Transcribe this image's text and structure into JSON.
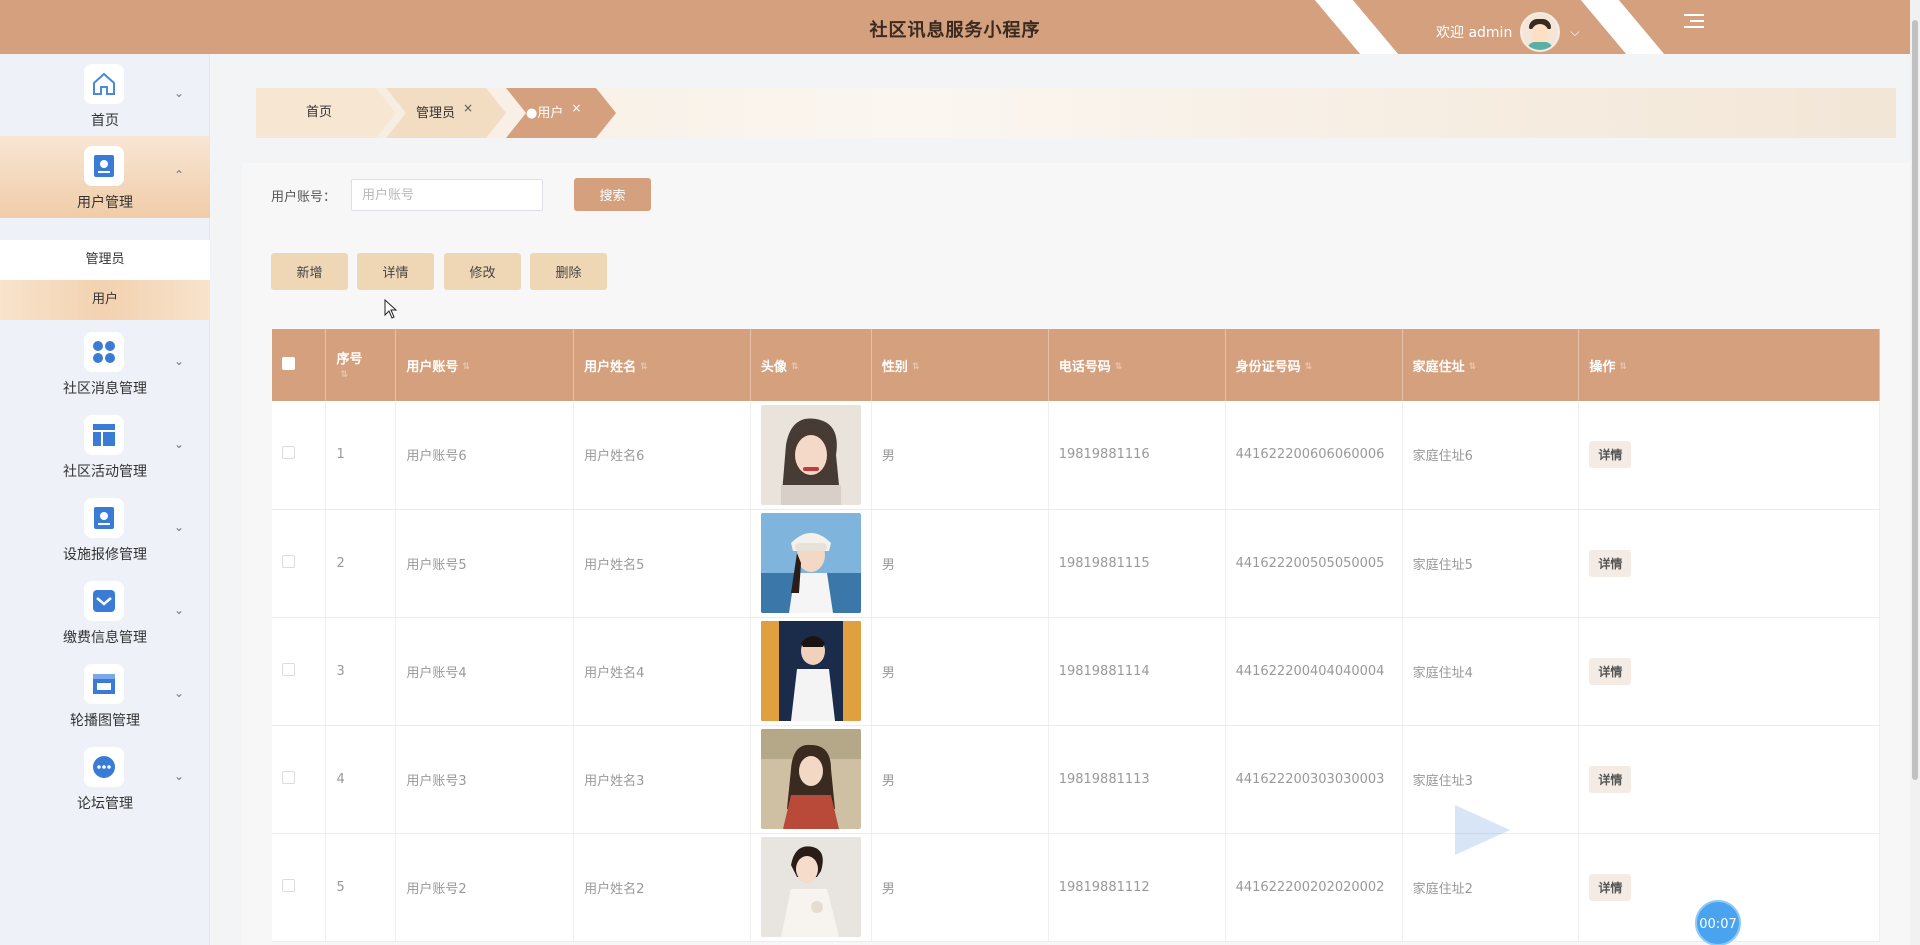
{
  "header": {
    "title": "社区讯息服务小程序",
    "welcome": "欢迎 admin",
    "colors": {
      "brand": "#d4a07e",
      "accent_light": "#efd7b6"
    }
  },
  "sidebar": {
    "items": [
      {
        "label": "首页",
        "icon": "home-icon"
      },
      {
        "label": "用户管理",
        "icon": "user-manage-icon"
      },
      {
        "label": "社区消息管理",
        "icon": "grid-icon"
      },
      {
        "label": "社区活动管理",
        "icon": "layout-icon"
      },
      {
        "label": "设施报修管理",
        "icon": "badge-icon"
      },
      {
        "label": "缴费信息管理",
        "icon": "mail-icon"
      },
      {
        "label": "轮播图管理",
        "icon": "store-icon"
      },
      {
        "label": "论坛管理",
        "icon": "chat-icon"
      }
    ],
    "sub_items": [
      "管理员",
      "用户"
    ]
  },
  "tabs": [
    {
      "label": "首页"
    },
    {
      "label": "管理员"
    },
    {
      "label": "●用户"
    }
  ],
  "search": {
    "label": "用户账号：",
    "placeholder": "用户账号",
    "button": "搜索"
  },
  "actions": [
    "新增",
    "详情",
    "修改",
    "删除"
  ],
  "table": {
    "headers": [
      "序号",
      "用户账号",
      "用户姓名",
      "头像",
      "性别",
      "电话号码",
      "身份证号码",
      "家庭住址",
      "操作"
    ],
    "rows": [
      {
        "index": "1",
        "account": "用户账号6",
        "name": "用户姓名6",
        "gender": "男",
        "phone": "19819881116",
        "id_card": "441622200606060006",
        "address": "家庭住址6",
        "op": "详情"
      },
      {
        "index": "2",
        "account": "用户账号5",
        "name": "用户姓名5",
        "gender": "男",
        "phone": "19819881115",
        "id_card": "441622200505050005",
        "address": "家庭住址5",
        "op": "详情"
      },
      {
        "index": "3",
        "account": "用户账号4",
        "name": "用户姓名4",
        "gender": "男",
        "phone": "19819881114",
        "id_card": "441622200404040004",
        "address": "家庭住址4",
        "op": "详情"
      },
      {
        "index": "4",
        "account": "用户账号3",
        "name": "用户姓名3",
        "gender": "男",
        "phone": "19819881113",
        "id_card": "441622200303030003",
        "address": "家庭住址3",
        "op": "详情"
      },
      {
        "index": "5",
        "account": "用户账号2",
        "name": "用户姓名2",
        "gender": "男",
        "phone": "19819881112",
        "id_card": "441622200202020002",
        "address": "家庭住址2",
        "op": "详情"
      }
    ]
  },
  "overlay": {
    "timer": "00:07"
  }
}
